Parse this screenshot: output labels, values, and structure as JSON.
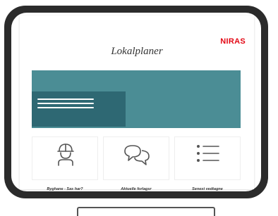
{
  "header": {
    "logo_text": "NIRAS",
    "title": "Lokalplaner"
  },
  "cards": [
    {
      "label": "Byghane - Sas har?",
      "icon": "worker-helmet-icon"
    },
    {
      "label": "Aktuelle forlagsr",
      "icon": "chat-bubbles-icon"
    },
    {
      "label": "Senest vedtagne",
      "icon": "list-icon"
    }
  ],
  "colors": {
    "brand_red": "#e30613",
    "hero_teal": "#4b8d95",
    "hero_panel": "#2e6873",
    "frame": "#2b2b2b"
  }
}
